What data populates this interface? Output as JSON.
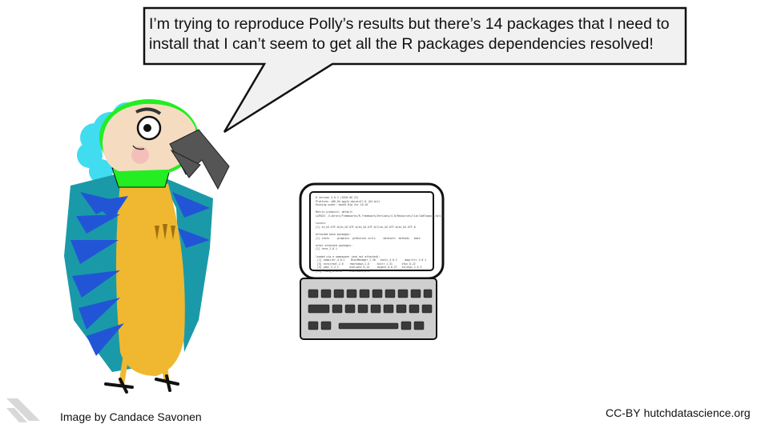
{
  "speech_bubble": {
    "text": "I’m trying to reproduce Polly’s results but there’s 14 packages that I need to install that I can’t seem to get all the R packages dependencies resolved!"
  },
  "credit": {
    "text": "Image by Candace Savonen"
  },
  "license": {
    "badge": "CC-BY",
    "site": "hutchdatascience.org"
  },
  "screen_lines": [
    "R version 4.0.2 (2020-06-22)",
    "Platform: x86_64-apple-darwin17.0 (64-bit)",
    "Running under: macOS Big Sur 10.16",
    "",
    "Matrix products: default",
    "LAPACK: /Library/Frameworks/R.framework/Versions/4.0/Resources/lib/libRlapack.dylib",
    "",
    "Locale:",
    "[1] en_US.UTF-8/en_US.UTF-8/en_US.UTF-8/C/en_US.UTF-8/en_US.UTF-8",
    "",
    "attached base packages:",
    "[1] stats     graphics  grDevices utils     datasets  methods   base",
    "",
    "other attached packages:",
    "[1] here_1.0.1",
    "",
    "loaded via a namespace (and not attached):",
    " [1] compiler_4.0.2    BiocManager_1.30   tools_4.0.2     magrittr_2.0.1",
    " [5] rprojroot_2.0    rmarkdown_2.6     knitr_1.31      xfun_0.22",
    " [9] yaml_2.2.1       evaluate_0.14     digest_0.6.27   stringi_1.5.3",
    "[13] rlang_0.4.10     htmltools_0.5"
  ],
  "colors": {
    "parrot_teal": "#1a9aa8",
    "parrot_blue": "#2255d6",
    "parrot_yellow": "#f0b830",
    "parrot_green": "#22ee22",
    "parrot_cyan": "#40dcf0",
    "beak": "#555555",
    "face": "#f5dcc0"
  }
}
